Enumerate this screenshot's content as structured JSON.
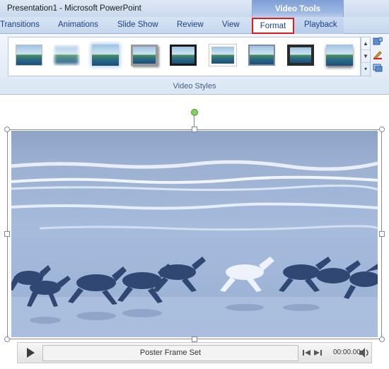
{
  "window": {
    "title": "Presentation1 - Microsoft PowerPoint",
    "contextual_group": "Video Tools"
  },
  "tabs": [
    {
      "label": "Transitions"
    },
    {
      "label": "Animations"
    },
    {
      "label": "Slide Show"
    },
    {
      "label": "Review"
    },
    {
      "label": "View"
    },
    {
      "label": "Format",
      "selected": true
    },
    {
      "label": "Playback"
    }
  ],
  "ribbon": {
    "group_label": "Video Styles",
    "gallery_items": [
      {
        "name": "style-simple-frame"
      },
      {
        "name": "style-soft-edge"
      },
      {
        "name": "style-glow"
      },
      {
        "name": "style-shadow-rectangle"
      },
      {
        "name": "style-black-frame"
      },
      {
        "name": "style-white-frame"
      },
      {
        "name": "style-thin-frame"
      },
      {
        "name": "style-thick-frame"
      },
      {
        "name": "style-center-shadow"
      }
    ],
    "scroll_icons": [
      "scroll-up-icon",
      "scroll-down-icon",
      "gallery-more-icon"
    ],
    "side_tool_icons": [
      "video-shape-icon",
      "video-border-icon",
      "video-effects-icon"
    ]
  },
  "player": {
    "status": "Poster Frame Set",
    "time": "00:00.00",
    "icons": [
      "play-icon",
      "move-back-icon",
      "move-forward-icon",
      "volume-icon"
    ]
  },
  "colors": {
    "accent_selected_tab_outline": "#d81d1d",
    "contextual_tab_color": "#7e9fd6",
    "video_tint": "#8fa6cc"
  }
}
